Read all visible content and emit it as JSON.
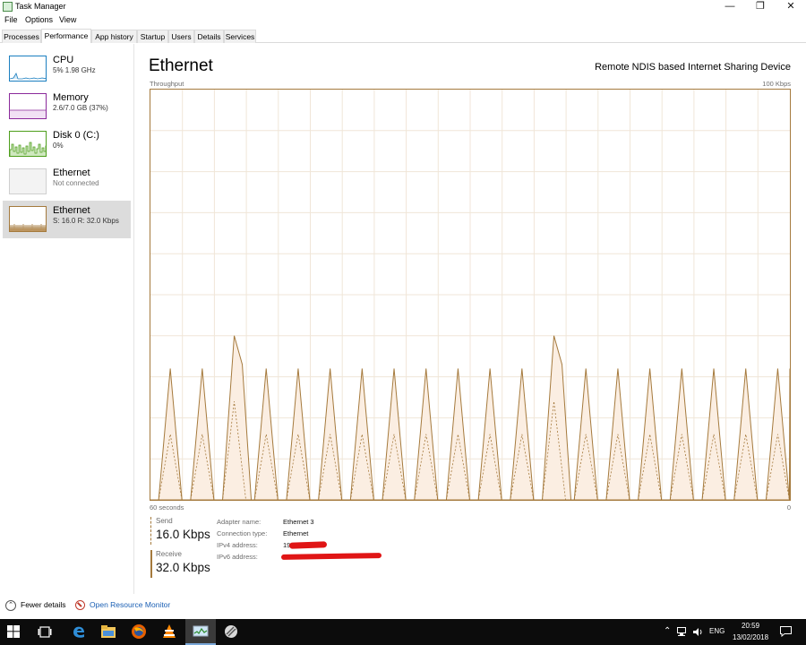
{
  "window": {
    "title": "Task Manager"
  },
  "menu": [
    "File",
    "Options",
    "View"
  ],
  "tabs": [
    "Processes",
    "Performance",
    "App history",
    "Startup",
    "Users",
    "Details",
    "Services"
  ],
  "active_tab": "Performance",
  "sidebar": {
    "items": [
      {
        "name": "CPU",
        "sub": "5%  1.98 GHz",
        "color": "#1b7fc0"
      },
      {
        "name": "Memory",
        "sub": "2.6/7.0 GB (37%)",
        "color": "#8b2a9b"
      },
      {
        "name": "Disk 0 (C:)",
        "sub": "0%",
        "color": "#4d9e1b"
      },
      {
        "name": "Ethernet",
        "sub": "Not connected",
        "color": "#a57a3d"
      },
      {
        "name": "Ethernet",
        "sub": "S: 16.0  R: 32.0 Kbps",
        "color": "#a57a3d"
      }
    ],
    "selected_index": 4
  },
  "main": {
    "title": "Ethernet",
    "device": "Remote NDIS based Internet Sharing Device",
    "graph_label": "Throughput",
    "graph_max": "100 Kbps",
    "time_label": "60 seconds",
    "zero_label": "0",
    "send": {
      "label": "Send",
      "value": "16.0 Kbps"
    },
    "receive": {
      "label": "Receive",
      "value": "32.0 Kbps"
    },
    "properties": [
      {
        "key": "Adapter name:",
        "value": "Ethernet 3"
      },
      {
        "key": "Connection type:",
        "value": "Ethernet"
      },
      {
        "key": "IPv4 address:",
        "value": "19"
      },
      {
        "key": "IPv6 address:",
        "value": ""
      }
    ]
  },
  "chart_data": {
    "type": "area",
    "ylabel": "Throughput",
    "ylim": [
      0,
      100
    ],
    "y_unit": "Kbps",
    "xlabel": "60 seconds",
    "grid": true,
    "accent_color": "#a57a3d",
    "receive_peaks_kbps": [
      32,
      32,
      40,
      32,
      32,
      32,
      32,
      32,
      32,
      32,
      32,
      32,
      40,
      32,
      32,
      32,
      32,
      32,
      32,
      32
    ],
    "send_peaks_kbps": [
      16,
      16,
      24,
      16,
      16,
      16,
      16,
      16,
      16,
      16,
      16,
      16,
      24,
      16,
      16,
      16,
      16,
      16,
      16,
      16
    ]
  },
  "footer": {
    "fewer_details": "Fewer details",
    "resource_monitor": "Open Resource Monitor"
  },
  "taskbar": {
    "lang": "ENG",
    "time": "20:59",
    "date": "13/02/2018"
  }
}
